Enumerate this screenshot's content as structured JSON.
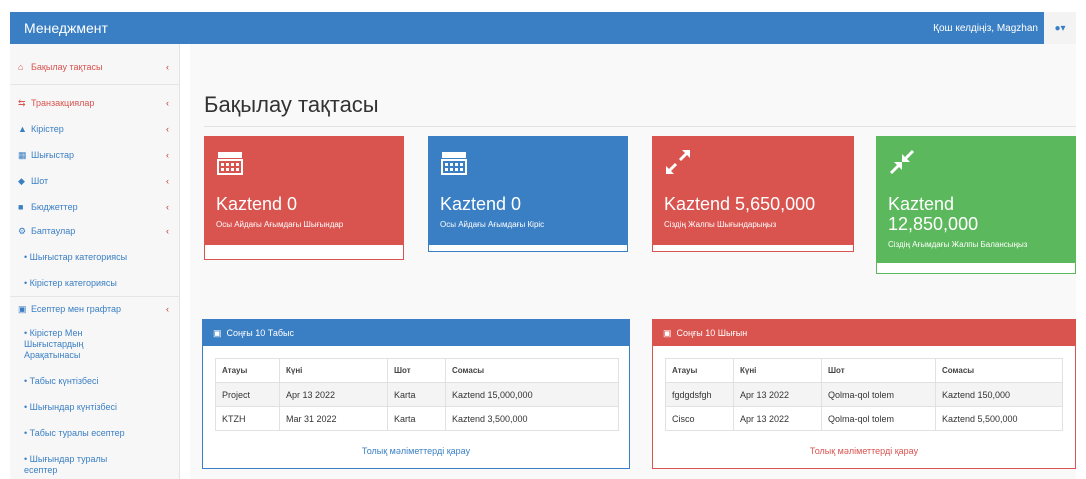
{
  "navbar": {
    "brand": "Менеджмент",
    "welcome": "Қош келдіңіз, Magzhan",
    "user_icon": "user-icon"
  },
  "sidebar": {
    "items": [
      {
        "label": "Бақылау тақтасы",
        "icon": "home-icon"
      },
      {
        "label": "Транзакциялар",
        "icon": "exchange-icon"
      },
      {
        "label": "Кірістер",
        "icon": "bank-icon"
      },
      {
        "label": "Шығыстар",
        "icon": "calendar-icon"
      },
      {
        "label": "Шот",
        "icon": "tag-icon"
      },
      {
        "label": "Бюджеттер",
        "icon": "list-icon"
      },
      {
        "label": "Баптаулар",
        "icon": "gears-icon"
      },
      {
        "label": "Шығыстар категориясы",
        "icon": "bullet-icon"
      },
      {
        "label": "Кірістер категориясы",
        "icon": "bullet-icon"
      },
      {
        "label": "Есептер мен графтар",
        "icon": "chart-icon"
      },
      {
        "label": "Кірістер Мен Шығыстардың Арақатынасы",
        "icon": "bullet-icon"
      },
      {
        "label": "Табыс күнтізбесі",
        "icon": "bullet-icon"
      },
      {
        "label": "Шығындар күнтізбесі",
        "icon": "bullet-icon"
      },
      {
        "label": "Табыс туралы есептер",
        "icon": "bullet-icon"
      },
      {
        "label": "Шығындар туралы есептер",
        "icon": "bullet-icon"
      }
    ]
  },
  "main": {
    "title": "Бақылау тақтасы",
    "stats": [
      {
        "value": "Kaztend 0",
        "caption": "Осы Айдағы Ағымдағы Шығындар",
        "icon": "calendar-icon",
        "color": "#d9534f"
      },
      {
        "value": "Kaztend 0",
        "caption": "Осы Айдағы Ағымдағы Кіріс",
        "icon": "calendar-icon",
        "color": "#3a7fc4"
      },
      {
        "value": "Kaztend 5,650,000",
        "caption": "Сіздің Жалпы Шығындарыңыз",
        "icon": "expand-icon",
        "color": "#d9534f"
      },
      {
        "value": "Kaztend 12,850,000",
        "caption": "Сіздің Ағымдағы Жалпы Балансыңыз",
        "icon": "compress-icon",
        "color": "#5cb85c"
      }
    ],
    "income_panel": {
      "title": "Соңғы 10 Табыс",
      "columns": [
        "Атауы",
        "Күні",
        "Шот",
        "Сомасы"
      ],
      "rows": [
        [
          "Project",
          "Apr 13 2022",
          "Karta",
          "Kaztend 15,000,000"
        ],
        [
          "KTZH",
          "Mar 31 2022",
          "Karta",
          "Kaztend 3,500,000"
        ]
      ],
      "more": "Толық мәліметтерді қарау"
    },
    "expense_panel": {
      "title": "Соңғы 10 Шығын",
      "columns": [
        "Атауы",
        "Күні",
        "Шот",
        "Сомасы"
      ],
      "rows": [
        [
          "fgdgdsfgh",
          "Apr 13 2022",
          "Qolma-qol tolem",
          "Kaztend 150,000"
        ],
        [
          "Cisco",
          "Apr 13 2022",
          "Qolma-qol tolem",
          "Kaztend 5,500,000"
        ]
      ],
      "more": "Толық мәліметтерді қарау"
    }
  }
}
